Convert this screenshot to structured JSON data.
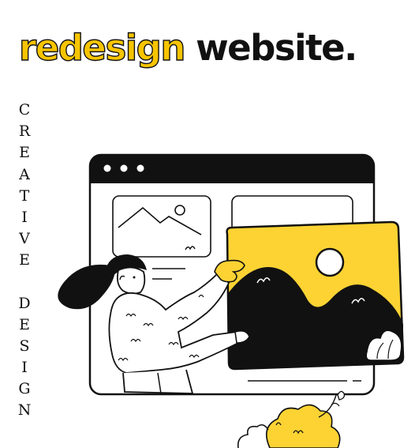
{
  "headline": {
    "word_1": "redesign",
    "word_2": "website."
  },
  "side_label": {
    "line_1": "CREATIVE",
    "line_2": "DESIGN"
  },
  "colors": {
    "accent_yellow": "#f7c400",
    "ink": "#111111",
    "background": "#ffffff"
  },
  "illustration": {
    "icons": [
      "browser-window",
      "image-placeholder",
      "woman-figure",
      "decorative-plant"
    ]
  }
}
